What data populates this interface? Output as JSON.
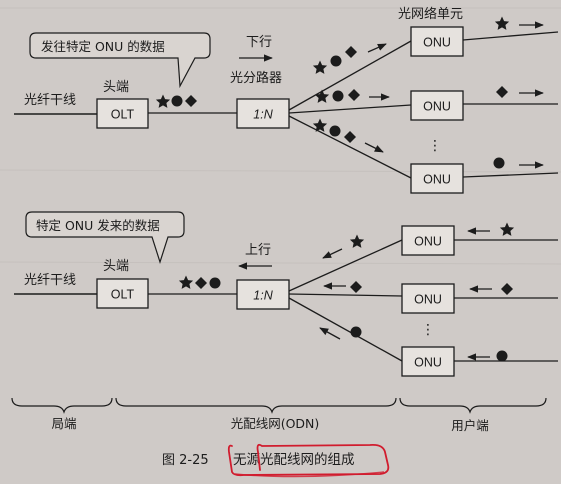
{
  "top": {
    "callout": "发往特定 ONU 的数据",
    "trunk_label": "光纤干线",
    "head_label": "头端",
    "olt": "OLT",
    "direction": "下行",
    "splitter_label": "光分路器",
    "splitter": "1:N",
    "onu_group_label": "光网络单元",
    "onus": [
      "ONU",
      "ONU",
      "ONU"
    ],
    "ellipsis": "⋮"
  },
  "bottom": {
    "callout": "特定 ONU 发来的数据",
    "trunk_label": "光纤干线",
    "head_label": "头端",
    "olt": "OLT",
    "direction": "上行",
    "splitter": "1:N",
    "onus": [
      "ONU",
      "ONU",
      "ONU"
    ],
    "ellipsis": "⋮"
  },
  "brackets": {
    "local": "局端",
    "odn": "光配线网(ODN)",
    "user": "用户端"
  },
  "caption": {
    "number": "图 2-25",
    "title": "无源光配线网的组成"
  },
  "colors": {
    "ink": "#1c1c1c",
    "paper": "#cfcac7",
    "box_fill": "#e6e2de",
    "highlight": "#d11c2e"
  },
  "icons": {
    "star": "star-icon",
    "circle": "circle-icon",
    "diamond": "diamond-icon",
    "arrow": "arrow-icon"
  }
}
